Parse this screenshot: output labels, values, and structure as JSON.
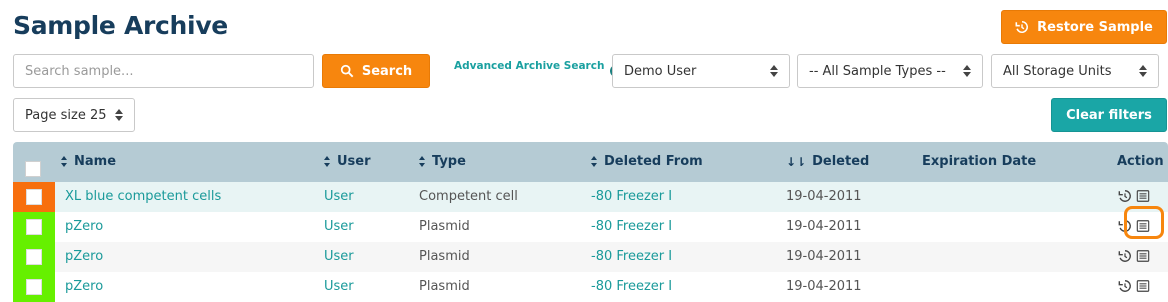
{
  "page": {
    "title": "Sample Archive"
  },
  "toolbar": {
    "restore_label": "Restore Sample",
    "search_placeholder": "Search sample...",
    "search_label": "Search",
    "advanced_search_label": "Advanced Archive Search",
    "clear_filters_label": "Clear filters"
  },
  "filters": {
    "user": "Demo User",
    "sample_type": "-- All Sample Types --",
    "storage_unit": "All Storage Units",
    "page_size": "Page size 25"
  },
  "table": {
    "columns": {
      "name": "Name",
      "user": "User",
      "type": "Type",
      "deleted_from": "Deleted From",
      "deleted": "Deleted",
      "expiration": "Expiration Date",
      "action": "Action"
    },
    "rows": [
      {
        "name": "XL blue competent cells",
        "user": "User",
        "type": "Competent cell",
        "deleted_from": "-80 Freezer I",
        "deleted": "19-04-2011",
        "expiration": "",
        "flag_color": "#f76f0e"
      },
      {
        "name": "pZero",
        "user": "User",
        "type": "Plasmid",
        "deleted_from": "-80 Freezer I",
        "deleted": "19-04-2011",
        "expiration": "",
        "flag_color": "#66f000"
      },
      {
        "name": "pZero",
        "user": "User",
        "type": "Plasmid",
        "deleted_from": "-80 Freezer I",
        "deleted": "19-04-2011",
        "expiration": "",
        "flag_color": "#66f000"
      },
      {
        "name": "pZero",
        "user": "User",
        "type": "Plasmid",
        "deleted_from": "-80 Freezer I",
        "deleted": "19-04-2011",
        "expiration": "",
        "flag_color": "#66f000"
      }
    ]
  },
  "colors": {
    "accent_orange": "#f7860e",
    "teal": "#1aa6a6",
    "header_bg": "#b5cbd4",
    "title": "#173d5c"
  },
  "icons": {
    "restore": "history-icon",
    "search": "search-icon",
    "help": "question-circle-icon",
    "details": "list-detail-icon"
  }
}
